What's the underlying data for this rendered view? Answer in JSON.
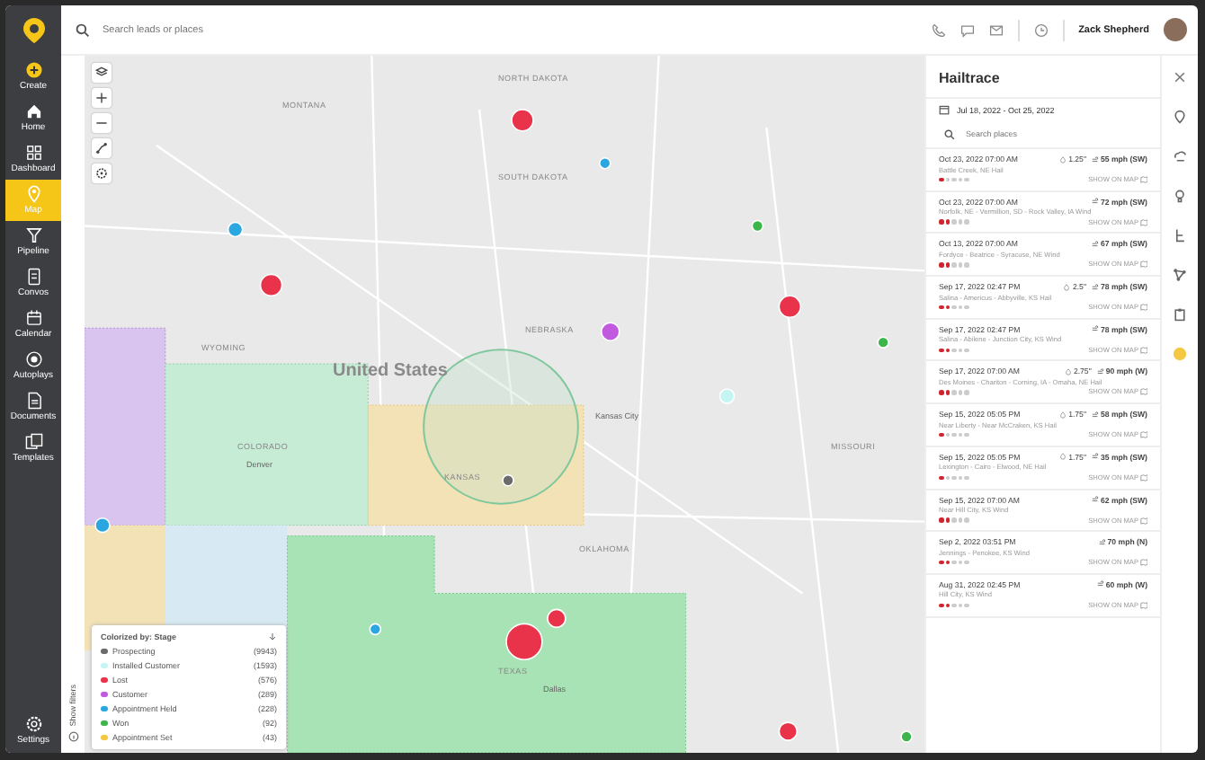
{
  "sidebar": {
    "items": [
      {
        "label": "Create",
        "kind": "create",
        "selected": false
      },
      {
        "label": "Home",
        "kind": "home",
        "selected": false
      },
      {
        "label": "Dashboard",
        "kind": "dashboard",
        "selected": false
      },
      {
        "label": "Map",
        "kind": "map",
        "selected": true
      },
      {
        "label": "Pipeline",
        "kind": "pipeline",
        "selected": false
      },
      {
        "label": "Convos",
        "kind": "convos",
        "selected": false
      },
      {
        "label": "Calendar",
        "kind": "calendar",
        "selected": false
      },
      {
        "label": "Autoplays",
        "kind": "autoplays",
        "selected": false
      },
      {
        "label": "Documents",
        "kind": "documents",
        "selected": false
      },
      {
        "label": "Templates",
        "kind": "templates",
        "selected": false
      }
    ],
    "footer": {
      "label": "Settings",
      "selected": false
    }
  },
  "topbar": {
    "search": {
      "placeholder": "Search leads or places"
    },
    "user": {
      "name": "Zack Shepherd"
    }
  },
  "map": {
    "labels": [
      {
        "text": "MONTANA",
        "kind": "state"
      },
      {
        "text": "WYOMING",
        "kind": "state"
      },
      {
        "text": "NORTH DAKOTA",
        "kind": "state"
      },
      {
        "text": "SOUTH DAKOTA",
        "kind": "state"
      },
      {
        "text": "NEBRASKA",
        "kind": "state"
      },
      {
        "text": "COLORADO",
        "kind": "state"
      },
      {
        "text": "KANSAS",
        "kind": "state"
      },
      {
        "text": "MISSOURI",
        "kind": "state"
      },
      {
        "text": "OKLAHOMA",
        "kind": "state"
      },
      {
        "text": "TEXAS",
        "kind": "state"
      },
      {
        "text": "United States",
        "kind": "country"
      },
      {
        "text": "Kansas City",
        "kind": "city"
      },
      {
        "text": "Denver",
        "kind": "city"
      },
      {
        "text": "Dallas",
        "kind": "city"
      }
    ],
    "show_filters": "Show filters",
    "legend": {
      "title": "Colorized by: Stage",
      "items": [
        {
          "label": "Prospecting",
          "count": "(9943)",
          "color": "#6b6b6b"
        },
        {
          "label": "Installed Customer",
          "count": "(1593)",
          "color": "#c4f5f3"
        },
        {
          "label": "Lost",
          "count": "(576)",
          "color": "#e8334a"
        },
        {
          "label": "Customer",
          "count": "(289)",
          "color": "#c25ae0"
        },
        {
          "label": "Appointment Held",
          "count": "(228)",
          "color": "#2aa7e0"
        },
        {
          "label": "Won",
          "count": "(92)",
          "color": "#3cb54a"
        },
        {
          "label": "Appointment Set",
          "count": "(43)",
          "color": "#f5c842"
        }
      ]
    }
  },
  "panel": {
    "title": "Hailtrace",
    "date_range": "Jul 18, 2022 - Oct 25, 2022",
    "search": {
      "placeholder": "Search places"
    },
    "events": [
      {
        "date": "Oct 23, 2022 07:00 AM",
        "hail": "1.25\"",
        "wind": "55 mph (SW)",
        "place": "Battle Creek, NE Hail",
        "stars": 1,
        "action": "SHOW ON MAP"
      },
      {
        "date": "Oct 23, 2022 07:00 AM",
        "wind": "72 mph (SW)",
        "place": "Norfolk, NE - Vermillion, SD - Rock Valley, IA Wind",
        "stars": 2,
        "action": "SHOW ON MAP"
      },
      {
        "date": "Oct 13, 2022 07:00 AM",
        "wind": "67 mph (SW)",
        "place": "Fordyce - Beatrice - Syracuse, NE Wind",
        "stars": 2,
        "action": "SHOW ON MAP"
      },
      {
        "date": "Sep 17, 2022 02:47 PM",
        "hail": "2.5\"",
        "wind": "78 mph (SW)",
        "place": "Salina - Americus - Abbyville, KS Hail",
        "stars": 2,
        "action": "SHOW ON MAP"
      },
      {
        "date": "Sep 17, 2022 02:47 PM",
        "wind": "78 mph (SW)",
        "place": "Salina - Abilene - Junction City, KS Wind",
        "stars": 2,
        "action": "SHOW ON MAP"
      },
      {
        "date": "Sep 17, 2022 07:00 AM",
        "hail": "2.75\"",
        "wind": "90 mph (W)",
        "place": "Des Moines - Chariton - Corning, IA - Omaha, NE Hail",
        "stars": 2,
        "action": "SHOW ON MAP"
      },
      {
        "date": "Sep 15, 2022 05:05 PM",
        "hail": "1.75\"",
        "wind": "58 mph (SW)",
        "place": "Near Liberty - Near McCraken, KS Hail",
        "stars": 1,
        "action": "SHOW ON MAP"
      },
      {
        "date": "Sep 15, 2022 05:05 PM",
        "hail": "1.75\"",
        "wind": "35 mph (SW)",
        "place": "Lexington - Cairo - Elwood, NE Hail",
        "stars": 1,
        "action": "SHOW ON MAP"
      },
      {
        "date": "Sep 15, 2022 07:00 AM",
        "wind": "62 mph (SW)",
        "place": "Near Hill City, KS Wind",
        "stars": 2,
        "action": "SHOW ON MAP"
      },
      {
        "date": "Sep 2, 2022 03:51 PM",
        "wind": "70 mph (N)",
        "place": "Jennings - Penokee, KS Wind",
        "stars": 2,
        "action": "SHOW ON MAP"
      },
      {
        "date": "Aug 31, 2022 02:45 PM",
        "wind": "60 mph (W)",
        "place": "Hill City, KS Wind",
        "stars": 2,
        "action": "SHOW ON MAP"
      }
    ]
  }
}
